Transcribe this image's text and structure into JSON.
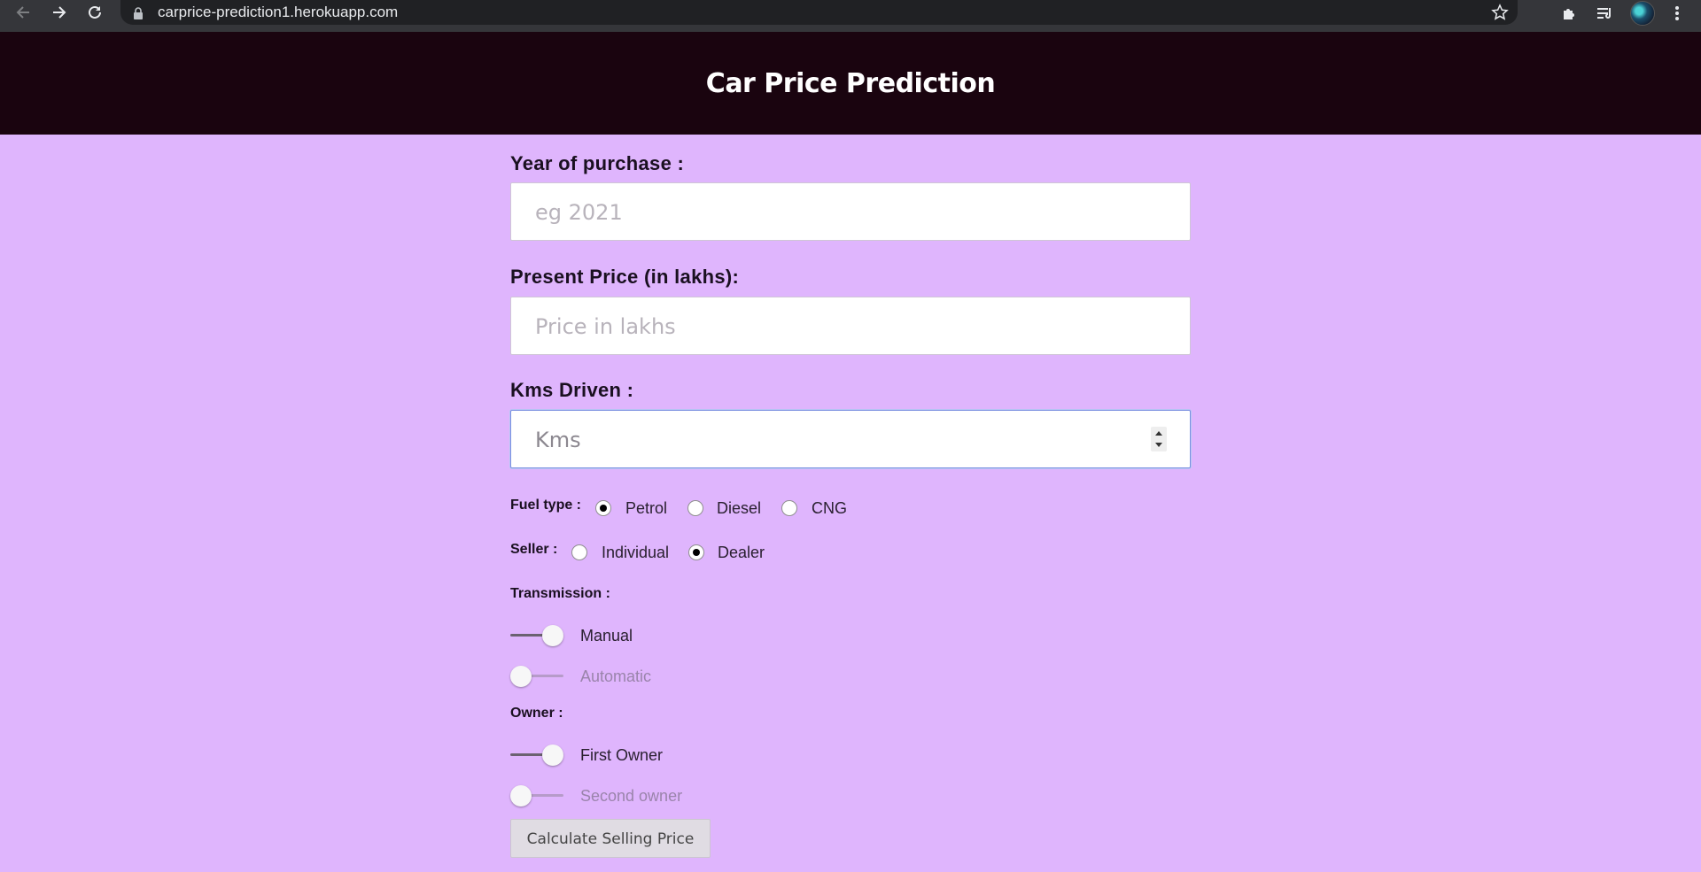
{
  "browser": {
    "url": "carprice-prediction1.herokuapp.com",
    "icons": [
      "back-arrow-icon",
      "forward-arrow-icon",
      "reload-icon",
      "lock-icon",
      "bookmark-star-icon",
      "extensions-puzzle-icon",
      "reading-list-icon",
      "profile-avatar",
      "more-vert-icon"
    ]
  },
  "header": {
    "title": "Car Price Prediction"
  },
  "form": {
    "year": {
      "label": "Year of purchase :",
      "placeholder": "eg 2021"
    },
    "price": {
      "label": "Present Price (in lakhs):",
      "placeholder": "Price in lakhs"
    },
    "kms": {
      "label": "Kms Driven :",
      "placeholder": "Kms"
    },
    "fuel": {
      "label": "Fuel type :",
      "options": [
        {
          "label": "Petrol",
          "checked": true
        },
        {
          "label": "Diesel",
          "checked": false
        },
        {
          "label": "CNG",
          "checked": false
        }
      ]
    },
    "seller": {
      "label": "Seller :",
      "options": [
        {
          "label": "Individual",
          "checked": false
        },
        {
          "label": "Dealer",
          "checked": true
        }
      ]
    },
    "transmission": {
      "label": "Transmission :",
      "options": [
        {
          "label": "Manual",
          "on": true
        },
        {
          "label": "Automatic",
          "on": false
        }
      ]
    },
    "owner": {
      "label": "Owner :",
      "options": [
        {
          "label": "First Owner",
          "on": true
        },
        {
          "label": "Second owner",
          "on": false
        }
      ]
    },
    "submit_label": "Calculate Selling Price"
  },
  "colors": {
    "page_bg": "#dfb5fd",
    "header_bg": "#1a040f",
    "chrome_bg": "#35363a"
  }
}
